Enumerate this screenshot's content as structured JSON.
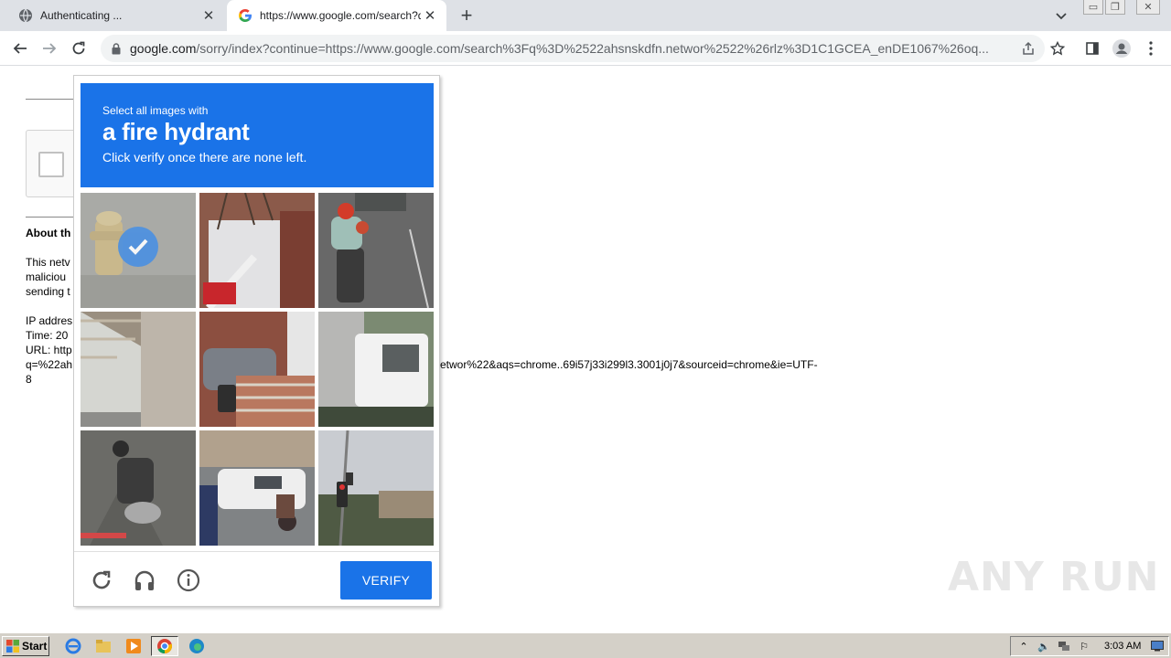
{
  "browser": {
    "tabs": [
      {
        "title": "Authenticating ...",
        "favicon": "globe-icon",
        "active": false
      },
      {
        "title": "https://www.google.com/search?q=",
        "favicon": "google-g-icon",
        "active": true
      }
    ],
    "address": {
      "host": "google.com",
      "path": "/sorry/index?continue=https://www.google.com/search%3Fq%3D%2522ahsnskdfn.networ%2522%26rlz%3D1C1GCEA_enDE1067%26oq..."
    }
  },
  "page": {
    "about_heading": "About th",
    "para_lines": [
      "This netv",
      "maliciou",
      "sending t"
    ],
    "info_lines": [
      "IP addres",
      "Time: 20",
      "URL: http",
      "q=%22ah",
      "8"
    ],
    "url_tail": "etwor%22&aqs=chrome..69i57j33i299l3.3001j0j7&sourceid=chrome&ie=UTF-"
  },
  "captcha": {
    "instruction": "Select all images with",
    "target": "a fire hydrant",
    "subtext": "Click verify once there are none left.",
    "tiles": [
      {
        "label": "fire hydrant",
        "selected": true
      },
      {
        "label": "house stairs",
        "selected": false
      },
      {
        "label": "motorcycle rider",
        "selected": false
      },
      {
        "label": "overpass",
        "selected": false
      },
      {
        "label": "car and steps",
        "selected": false
      },
      {
        "label": "white truck",
        "selected": false
      },
      {
        "label": "motorcycle",
        "selected": false
      },
      {
        "label": "van and scooter",
        "selected": false
      },
      {
        "label": "traffic light pole",
        "selected": false
      }
    ],
    "verify_label": "VERIFY"
  },
  "watermark": "ANY RUN",
  "taskbar": {
    "start_label": "Start",
    "clock": "3:03 AM"
  }
}
